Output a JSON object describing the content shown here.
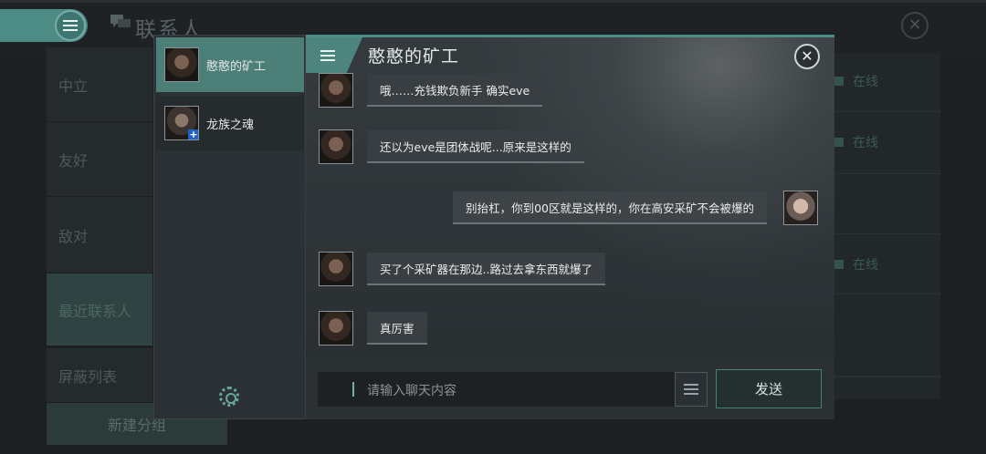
{
  "background": {
    "title": "联系人",
    "categories": [
      "中立",
      "友好",
      "敌对",
      "最近联系人",
      "屏蔽列表"
    ],
    "selected_category": "最近联系人",
    "new_group_label": "新建分组",
    "online_labels": [
      "在线",
      "在线",
      "在线"
    ]
  },
  "chat_list": {
    "items": [
      {
        "name": "憨憨的矿工",
        "avatar": "avatar-miner",
        "selected": true
      },
      {
        "name": "龙族之魂",
        "avatar": "avatar-dragon",
        "selected": false,
        "badge": "+"
      }
    ],
    "settings_icon": "gear-icon"
  },
  "chat": {
    "title": "憨憨的矿工",
    "close_icon": "close-icon",
    "messages": [
      {
        "from": "them",
        "text": "哦……充钱欺负新手 确实eve"
      },
      {
        "from": "them",
        "text": "还以为eve是团体战呢...原来是这样的"
      },
      {
        "from": "me",
        "text": "别抬杠，你到00区就是这样的，你在高安采矿不会被爆的"
      },
      {
        "from": "them",
        "text": "买了个采矿器在那边..路过去拿东西就爆了"
      },
      {
        "from": "them",
        "text": "真厉害"
      }
    ],
    "input_placeholder": "请输入聊天内容",
    "send_label": "发送"
  },
  "colors": {
    "accent": "#4d847e",
    "background": "#1c2023",
    "bubble": "#383e42"
  }
}
